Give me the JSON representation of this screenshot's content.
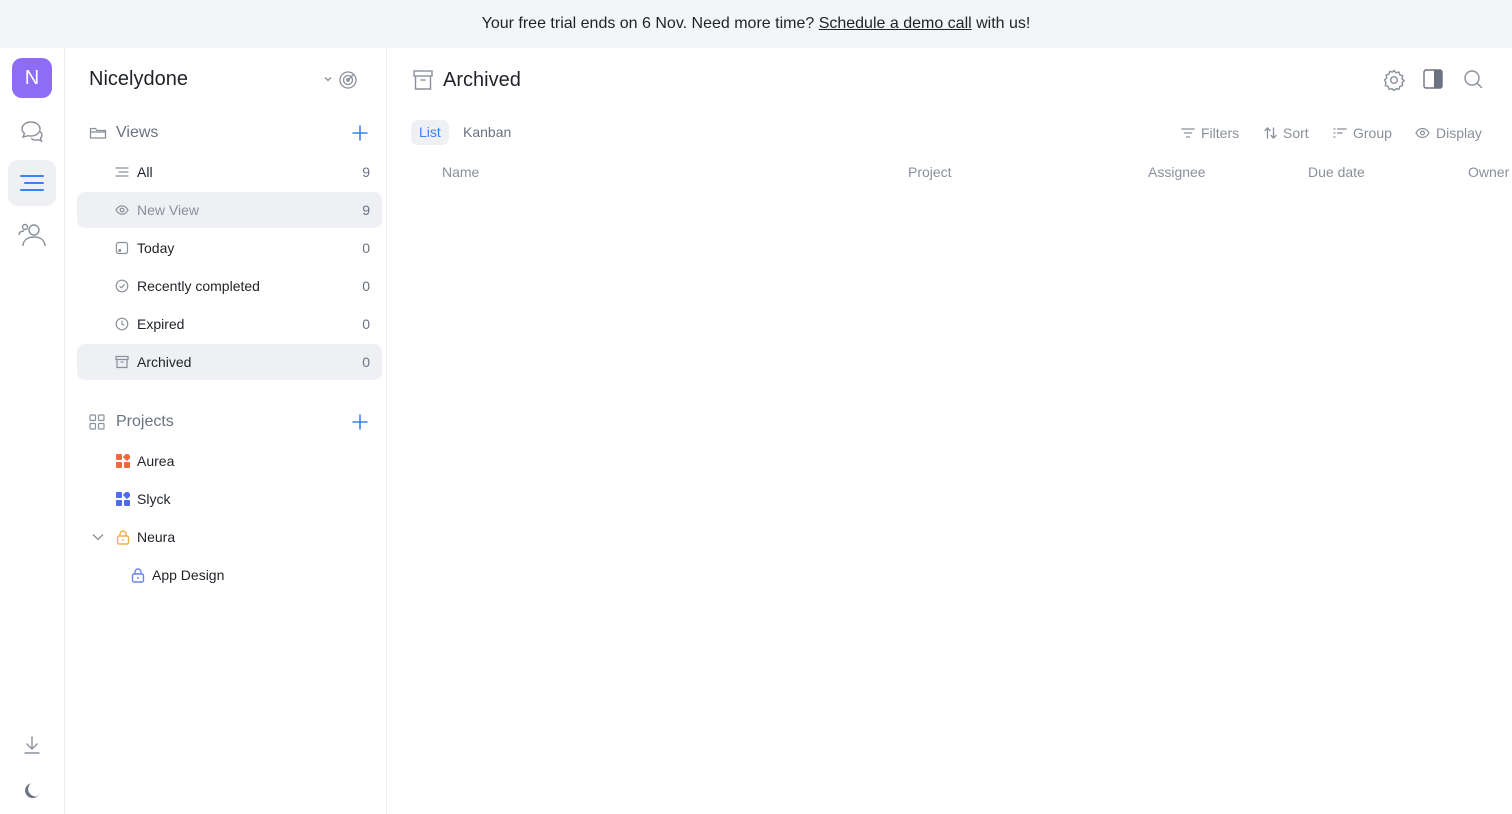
{
  "banner": {
    "prefix": "Your free trial ends on 6 Nov. Need more time? ",
    "link": "Schedule a demo call",
    "suffix": " with us!"
  },
  "rail": {
    "avatar_letter": "N"
  },
  "workspace": {
    "name": "Nicelydone"
  },
  "views": {
    "heading": "Views",
    "items": [
      {
        "label": "All",
        "count": "9",
        "icon": "list-icon"
      },
      {
        "label": "New View",
        "count": "9",
        "icon": "eye-icon"
      },
      {
        "label": "Today",
        "count": "0",
        "icon": "calendar-icon"
      },
      {
        "label": "Recently completed",
        "count": "0",
        "icon": "check-circle-icon"
      },
      {
        "label": "Expired",
        "count": "0",
        "icon": "clock-icon"
      },
      {
        "label": "Archived",
        "count": "0",
        "icon": "archive-icon"
      }
    ]
  },
  "projects": {
    "heading": "Projects",
    "items": [
      {
        "label": "Aurea",
        "color": "#f0683e"
      },
      {
        "label": "Slyck",
        "color": "#4f6bef"
      },
      {
        "label": "Neura",
        "color": "#f2b14b"
      },
      {
        "label": "App Design",
        "color": "#6b83f0"
      }
    ]
  },
  "main": {
    "title": "Archived",
    "tabs": [
      "List",
      "Kanban"
    ],
    "tools": [
      "Filters",
      "Sort",
      "Group",
      "Display"
    ],
    "columns": [
      "Name",
      "Project",
      "Assignee",
      "Due date",
      "Owner"
    ]
  },
  "colors": {
    "accent": "#3b82f6",
    "avatar": "#8f6cf5"
  }
}
